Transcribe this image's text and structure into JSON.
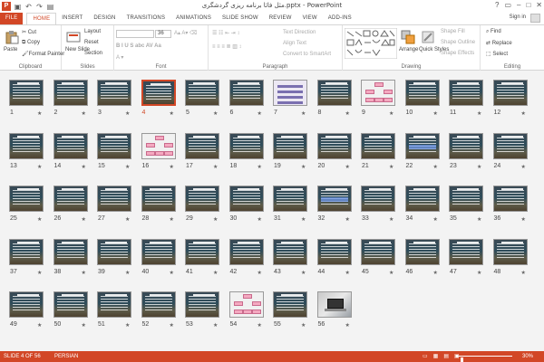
{
  "app": {
    "title": "مثل فاثا برنامه ریزی گردشگری.pptx - PowerPoint",
    "logo": "P",
    "qat": [
      "save-icon",
      "undo-icon",
      "redo-icon",
      "start-from-beginning-icon"
    ],
    "window_controls": [
      "?",
      "▭",
      "–",
      "□",
      "✕"
    ]
  },
  "ribbon_tabs": [
    "FILE",
    "HOME",
    "INSERT",
    "DESIGN",
    "TRANSITIONS",
    "ANIMATIONS",
    "SLIDE SHOW",
    "REVIEW",
    "VIEW",
    "ADD-INS"
  ],
  "active_tab": "HOME",
  "signin": "Sign in",
  "ribbon": {
    "clipboard": {
      "label": "Clipboard",
      "paste": "Paste",
      "cut": "Cut",
      "copy": "Copy",
      "format_painter": "Format Painter"
    },
    "slides": {
      "label": "Slides",
      "new_slide": "New Slide",
      "layout": "Layout",
      "reset": "Reset",
      "section": "Section"
    },
    "font": {
      "label": "Font",
      "size": "36"
    },
    "paragraph": {
      "label": "Paragraph",
      "text_direction": "Text Direction",
      "align_text": "Align Text",
      "convert_smartart": "Convert to SmartArt"
    },
    "drawing": {
      "label": "Drawing",
      "arrange": "Arrange",
      "quick_styles": "Quick Styles",
      "shape_fill": "Shape Fill",
      "shape_outline": "Shape Outline",
      "shape_effects": "Shape Effects"
    },
    "editing": {
      "label": "Editing",
      "find": "Find",
      "replace": "Replace",
      "select": "Select"
    }
  },
  "slides": [
    {
      "n": "1",
      "kind": "text"
    },
    {
      "n": "2",
      "kind": "text"
    },
    {
      "n": "3",
      "kind": "text"
    },
    {
      "n": "4",
      "kind": "text"
    },
    {
      "n": "5",
      "kind": "text"
    },
    {
      "n": "6",
      "kind": "text"
    },
    {
      "n": "7",
      "kind": "lavender"
    },
    {
      "n": "8",
      "kind": "text"
    },
    {
      "n": "9",
      "kind": "diagram"
    },
    {
      "n": "10",
      "kind": "text"
    },
    {
      "n": "11",
      "kind": "text"
    },
    {
      "n": "12",
      "kind": "text"
    },
    {
      "n": "13",
      "kind": "text"
    },
    {
      "n": "14",
      "kind": "text"
    },
    {
      "n": "15",
      "kind": "text"
    },
    {
      "n": "16",
      "kind": "diagram"
    },
    {
      "n": "17",
      "kind": "text"
    },
    {
      "n": "18",
      "kind": "text"
    },
    {
      "n": "19",
      "kind": "text"
    },
    {
      "n": "20",
      "kind": "text"
    },
    {
      "n": "21",
      "kind": "text"
    },
    {
      "n": "22",
      "kind": "highlight"
    },
    {
      "n": "23",
      "kind": "text"
    },
    {
      "n": "24",
      "kind": "text"
    },
    {
      "n": "25",
      "kind": "text"
    },
    {
      "n": "26",
      "kind": "text"
    },
    {
      "n": "27",
      "kind": "text"
    },
    {
      "n": "28",
      "kind": "text"
    },
    {
      "n": "29",
      "kind": "text"
    },
    {
      "n": "30",
      "kind": "text"
    },
    {
      "n": "31",
      "kind": "text"
    },
    {
      "n": "32",
      "kind": "highlight"
    },
    {
      "n": "33",
      "kind": "text"
    },
    {
      "n": "34",
      "kind": "text"
    },
    {
      "n": "35",
      "kind": "text"
    },
    {
      "n": "36",
      "kind": "text"
    },
    {
      "n": "37",
      "kind": "text"
    },
    {
      "n": "38",
      "kind": "text"
    },
    {
      "n": "39",
      "kind": "text"
    },
    {
      "n": "40",
      "kind": "text"
    },
    {
      "n": "41",
      "kind": "text"
    },
    {
      "n": "42",
      "kind": "text"
    },
    {
      "n": "43",
      "kind": "text"
    },
    {
      "n": "44",
      "kind": "text"
    },
    {
      "n": "45",
      "kind": "text"
    },
    {
      "n": "46",
      "kind": "text"
    },
    {
      "n": "47",
      "kind": "text"
    },
    {
      "n": "48",
      "kind": "text"
    },
    {
      "n": "49",
      "kind": "text"
    },
    {
      "n": "50",
      "kind": "text"
    },
    {
      "n": "51",
      "kind": "text"
    },
    {
      "n": "52",
      "kind": "text"
    },
    {
      "n": "53",
      "kind": "text"
    },
    {
      "n": "54",
      "kind": "diagram"
    },
    {
      "n": "55",
      "kind": "text"
    },
    {
      "n": "56",
      "kind": "photo"
    }
  ],
  "selected_slide": "4",
  "status": {
    "slide_of": "SLIDE 4 OF 56",
    "language": "PERSIAN",
    "zoom": "30%",
    "zoom_level_percent": 30,
    "view_icons": [
      "normal-view-icon",
      "slide-sorter-icon",
      "reading-view-icon",
      "slideshow-icon"
    ]
  },
  "colors": {
    "accent": "#d24726",
    "sorter_bg": "#f3f3f3"
  }
}
